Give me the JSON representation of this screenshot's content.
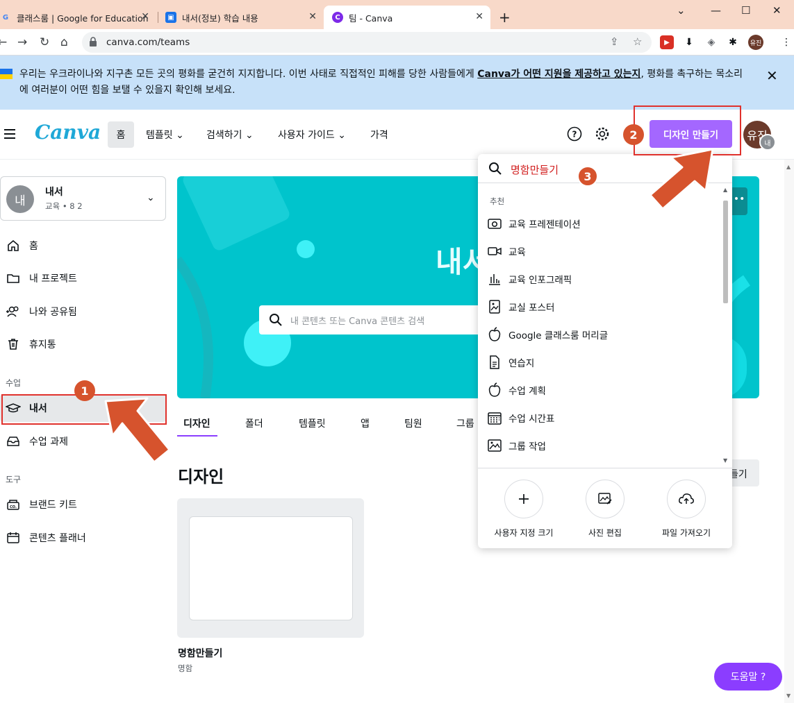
{
  "browser": {
    "tabs": [
      {
        "title": "클래스룸 | Google for Education",
        "favicon": "G"
      },
      {
        "title": "내서(정보) 학습 내용",
        "favicon": "classroom"
      },
      {
        "title": "팀 - Canva",
        "favicon": "canva"
      }
    ],
    "url": "canva.com/teams",
    "profile": "유진"
  },
  "banner": {
    "text_before": "우리는 우크라이나와 지구촌 모든 곳의 평화를 굳건히 지지합니다. 이번 사태로 직접적인 피해를 당한 사람들에게 ",
    "link": "Canva가 어떤 지원을 제공하고 있는지",
    "text_after": ", 평화를 촉구하는 목소리에 여러분이 어떤 힘을 보탤 수 있을지 확인해 보세요."
  },
  "header": {
    "logo": "Canva",
    "nav": [
      "홈",
      "템플릿",
      "검색하기",
      "사용자 가이드",
      "가격"
    ],
    "create_button": "디자인 만들기",
    "avatar_main": "유진",
    "avatar_sub": "내"
  },
  "sidebar": {
    "team": {
      "avatar": "내",
      "name": "내서",
      "sub": "교육 • 8 2"
    },
    "items": [
      "홈",
      "내 프로젝트",
      "나와 공유됨",
      "휴지통"
    ],
    "group_class": "수업",
    "class_items": [
      "내서",
      "수업 과제"
    ],
    "group_tools": "도구",
    "tool_items": [
      "브랜드 키트",
      "콘텐츠 플래너"
    ]
  },
  "main": {
    "hero_title": "내서",
    "search_placeholder": "내 콘텐츠 또는 Canva 콘텐츠 검색",
    "tabs": [
      "디자인",
      "폴더",
      "템플릿",
      "앱",
      "팀원",
      "그룹"
    ],
    "section_title": "디자인",
    "new_button": "들기",
    "card": {
      "title": "명함만들기",
      "sub": "명함"
    }
  },
  "dropdown": {
    "search_value": "명함만들기",
    "section": "추천",
    "items": [
      "교육 프레젠테이션",
      "교육",
      "교육 인포그래픽",
      "교실 포스터",
      "Google 클래스룸 머리글",
      "연습지",
      "수업 계획",
      "수업 시간표",
      "그룹 작업"
    ],
    "actions": [
      "사용자 지정 크기",
      "사진 편집",
      "파일 가져오기"
    ]
  },
  "help_button": "도움말 ?",
  "annotations": [
    "1",
    "2",
    "3"
  ],
  "colors": {
    "accent": "#8b3dff",
    "hero": "#00c4cc",
    "annotation": "#d6532d",
    "redbox": "#e0312c"
  }
}
